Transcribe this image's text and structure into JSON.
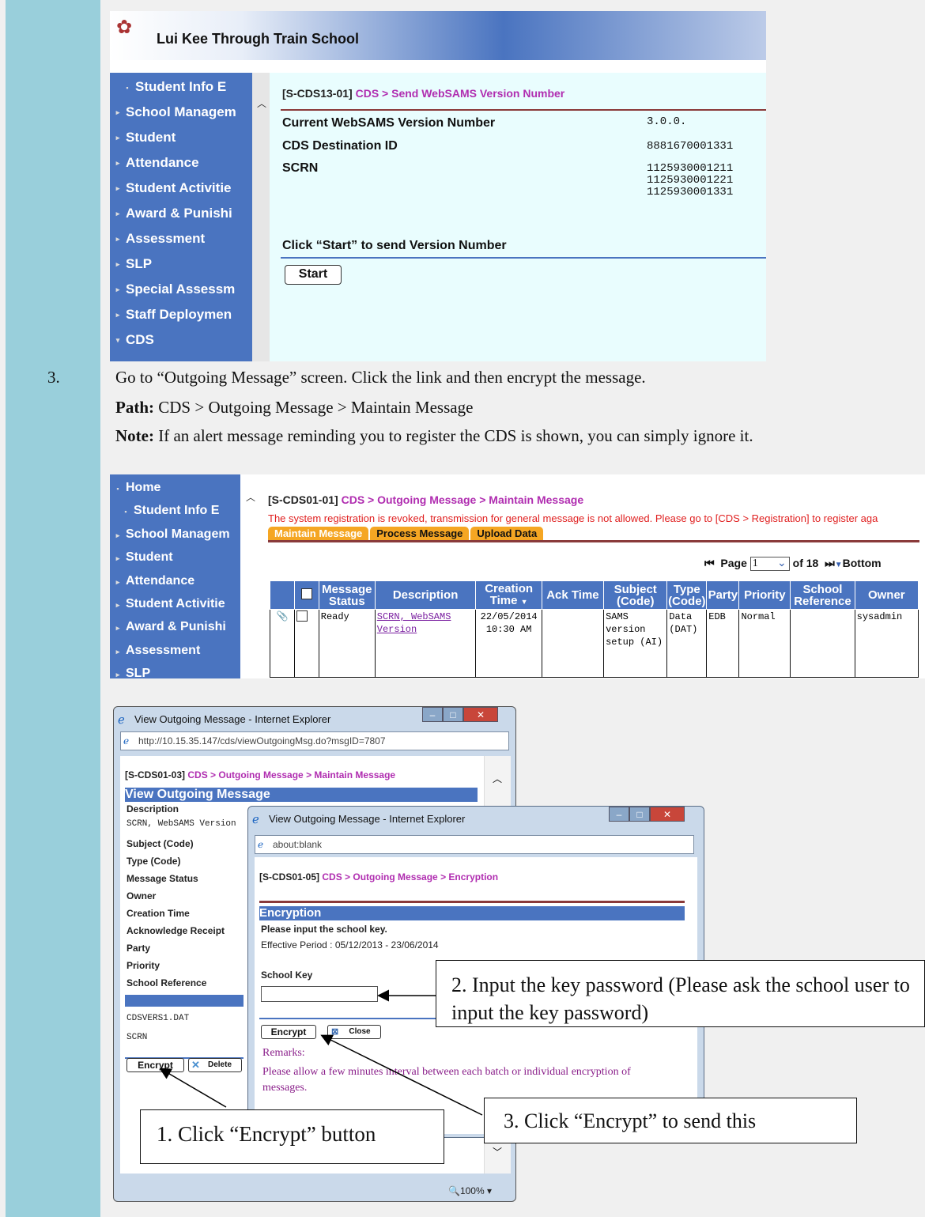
{
  "shot1": {
    "school_name": "Lui Kee Through Train School",
    "nav": [
      {
        "label": "Student Info E",
        "bullet": "▪"
      },
      {
        "label": "School Managem",
        "bullet": "▸"
      },
      {
        "label": "Student",
        "bullet": "▸"
      },
      {
        "label": "Attendance",
        "bullet": "▸"
      },
      {
        "label": "Student Activitie",
        "bullet": "▸"
      },
      {
        "label": "Award & Punishi",
        "bullet": "▸"
      },
      {
        "label": "Assessment",
        "bullet": "▸"
      },
      {
        "label": "SLP",
        "bullet": "▸"
      },
      {
        "label": "Special Assessm",
        "bullet": "▸"
      },
      {
        "label": "Staff Deploymen",
        "bullet": "▸"
      },
      {
        "label": "CDS",
        "bullet": "▾"
      }
    ],
    "screen_code": "[S-CDS13-01]",
    "breadcrumb": "CDS > Send WebSAMS Version Number",
    "fields": [
      {
        "label": "Current WebSAMS Version Number",
        "value": "3.0.0."
      },
      {
        "label": "CDS Destination ID",
        "value": "8881670001331"
      },
      {
        "label": "SCRN",
        "value": "1125930001211\n1125930001221\n1125930001331"
      }
    ],
    "instruction": "Click “Start” to send Version Number",
    "start_label": "Start"
  },
  "step3": {
    "number": "3.",
    "text": "Go to “Outgoing Message” screen. Click the link and then encrypt the message.",
    "path_label": "Path:",
    "path": "CDS > Outgoing Message > Maintain Message",
    "note_label": "Note:",
    "note": "If an alert message reminding you to register the CDS is shown, you can simply ignore it."
  },
  "shot2": {
    "nav": [
      {
        "label": "Home",
        "bullet": "▪"
      },
      {
        "label": "Student Info E",
        "bullet": "▪"
      },
      {
        "label": "School Managem",
        "bullet": "▸"
      },
      {
        "label": "Student",
        "bullet": "▸"
      },
      {
        "label": "Attendance",
        "bullet": "▸"
      },
      {
        "label": "Student Activitie",
        "bullet": "▸"
      },
      {
        "label": "Award & Punishi",
        "bullet": "▸"
      },
      {
        "label": "Assessment",
        "bullet": "▸"
      },
      {
        "label": "SLP",
        "bullet": "▸"
      }
    ],
    "screen_code": "[S-CDS01-01]",
    "breadcrumb": "CDS > Outgoing Message > Maintain Message",
    "alert": "The system registration is revoked, transmission for general message is not allowed. Please go to [CDS > Registration] to register aga",
    "tabs": [
      "Maintain Message",
      "Process Message",
      "Upload Data"
    ],
    "page_label": "Page",
    "page_value": "1",
    "of_pages": "of 18",
    "bottom_label": "Bottom",
    "columns": [
      "Message Status",
      "Description",
      "Creation Time",
      "Ack Time",
      "Subject (Code)",
      "Type (Code)",
      "Party",
      "Priority",
      "School Reference",
      "Owner"
    ],
    "row": {
      "status": "Ready",
      "description": "SCRN, WebSAMS Version",
      "creation_time": "22/05/2014 10:30 AM",
      "ack_time": "",
      "subject": "SAMS version setup (AI)",
      "type": "Data (DAT)",
      "party": "EDB",
      "priority": "Normal",
      "school_ref": "",
      "owner": "sysadmin"
    }
  },
  "win1": {
    "title": "View Outgoing Message - Internet Explorer",
    "url": "http://10.15.35.147/cds/viewOutgoingMsg.do?msgID=7807",
    "screen_code": "[S-CDS01-03]",
    "breadcrumb": "CDS > Outgoing Message > Maintain Message",
    "heading": "View Outgoing Message",
    "labels": [
      "Description",
      "Subject (Code)",
      "Type (Code)",
      "Message Status",
      "Owner",
      "Creation Time",
      "Acknowledge Receipt",
      "Party",
      "Priority",
      "School Reference"
    ],
    "description_value": "SCRN, WebSAMS Version",
    "file1": "CDSVERS1.DAT",
    "file2": "SCRN",
    "encrypt_label": "Encrypt",
    "delete_label": "Delete",
    "zoom": "100%"
  },
  "win2": {
    "title": "View Outgoing Message - Internet Explorer",
    "url": "about:blank",
    "screen_code": "[S-CDS01-05]",
    "breadcrumb": "CDS > Outgoing Message > Encryption",
    "heading": "Encryption",
    "prompt": "Please input the school key.",
    "effective": "Effective Period : 05/12/2013 - 23/06/2014",
    "school_key_label": "School Key",
    "school_key_value": "",
    "encrypt_label": "Encrypt",
    "close_label": "Close",
    "remarks_label": "Remarks:",
    "remarks": "Please allow a few minutes interval between each batch or individual encryption of messages."
  },
  "callouts": {
    "c1": "1. Click “Encrypt” button",
    "c2": "2. Input the key password (Please ask the school user to input the key password)",
    "c3": "3. Click “Encrypt” to send this"
  },
  "colors": {
    "nav_blue": "#4a74c0",
    "sidebar": "#99cfdb",
    "breadcrumb": "#b02db0",
    "alert": "#e02020",
    "tab": "#f5a623"
  }
}
